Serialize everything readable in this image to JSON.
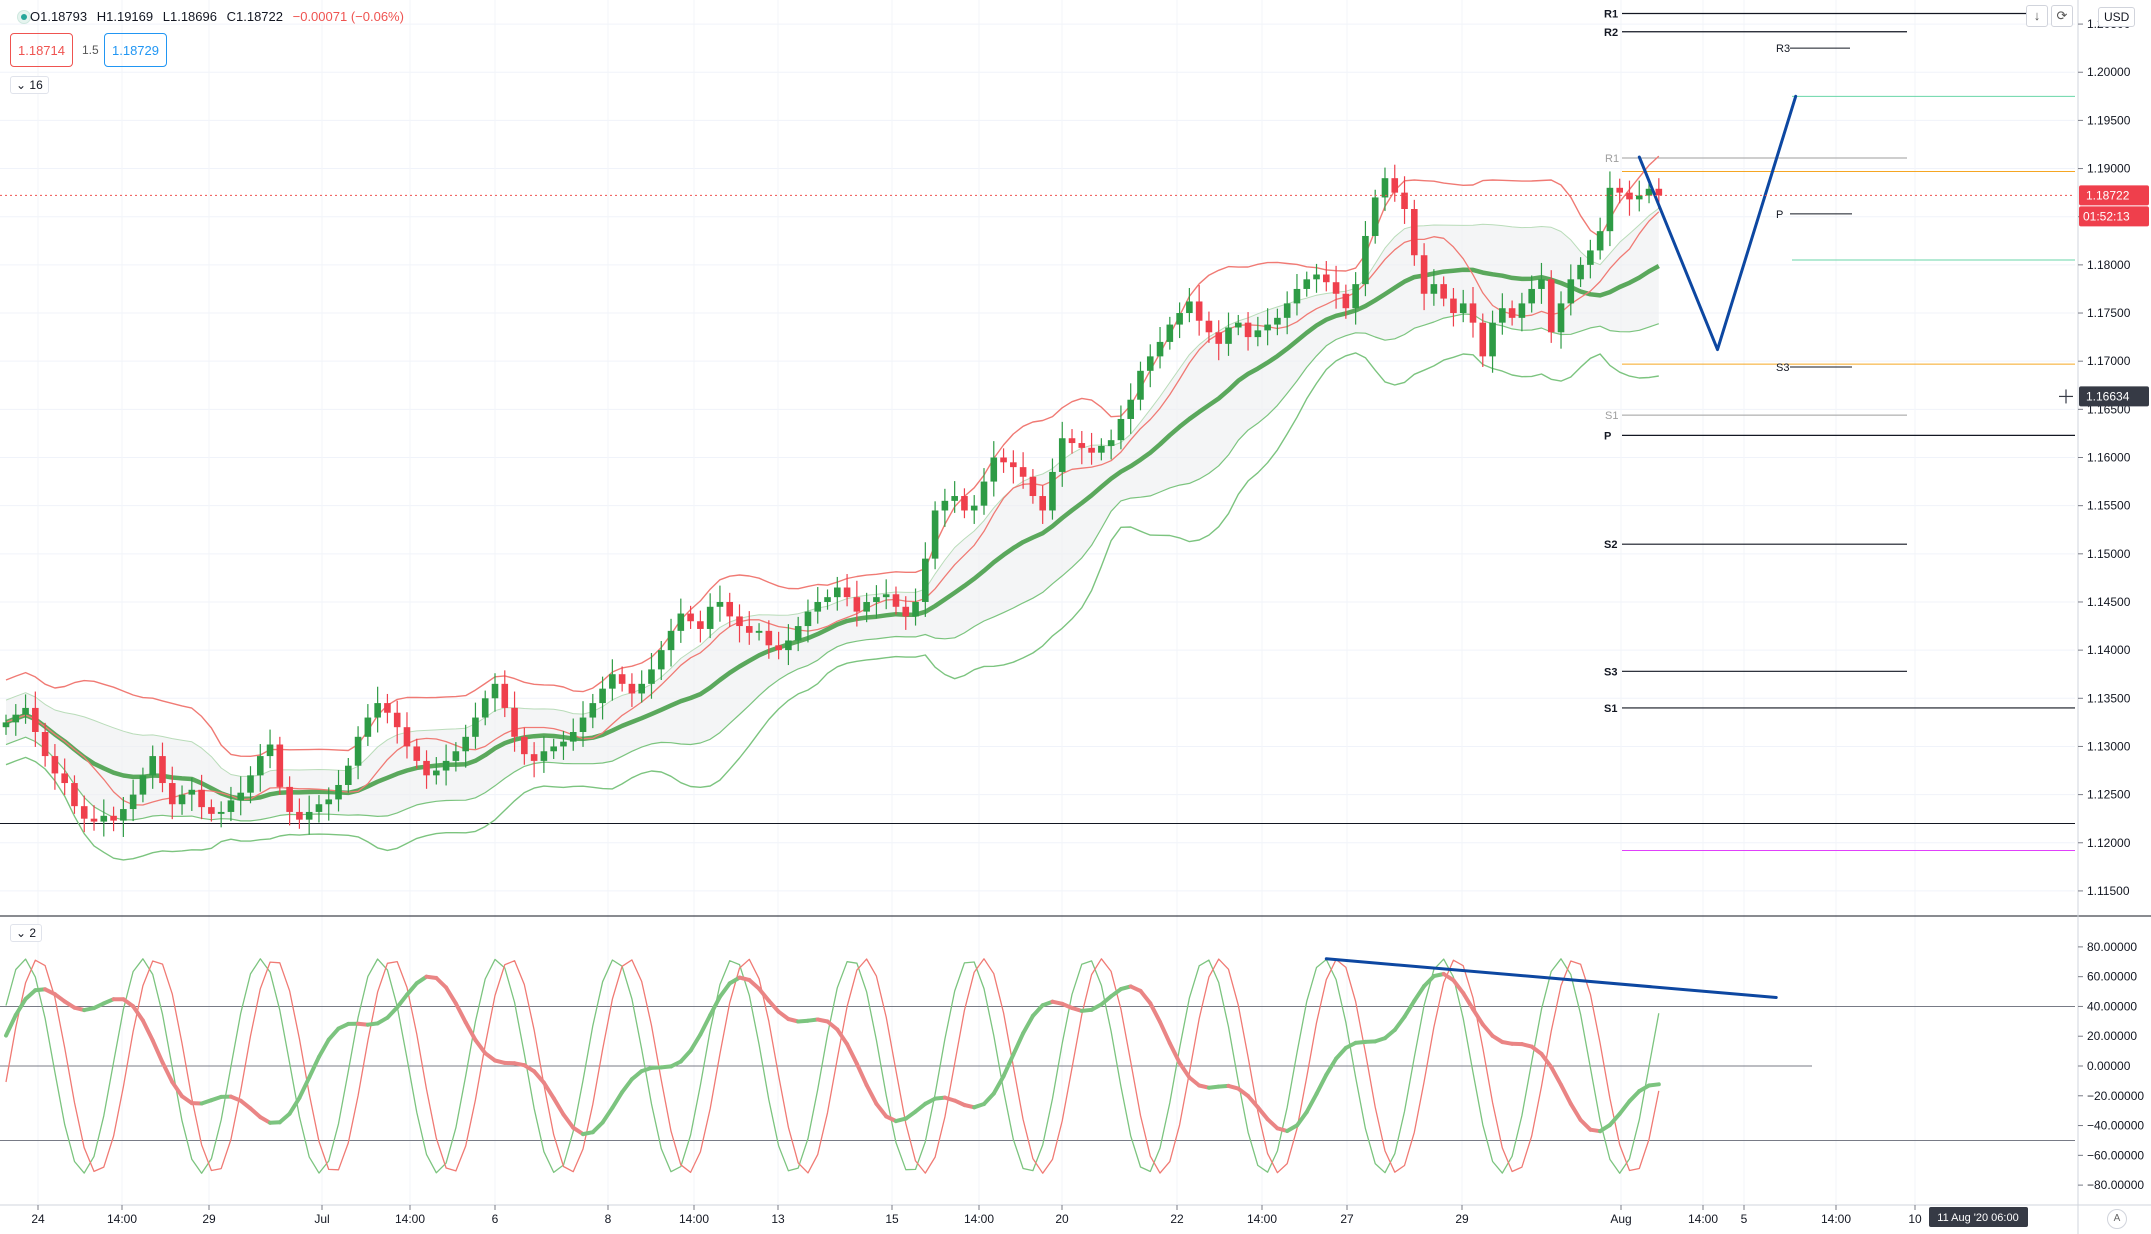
{
  "header": {
    "open": "O1.18793",
    "high": "H1.19169",
    "low": "L1.18696",
    "close": "C1.18722",
    "change": "−0.00071 (−0.06%)",
    "sell_price": "1.18714",
    "spread": "1.5",
    "buy_price": "1.18729",
    "main_collapse": "16",
    "osc_collapse": "2",
    "currency": "USD"
  },
  "colors": {
    "up": "#2e9b45",
    "down": "#ef3f4c",
    "band_red": "#f07a74",
    "band_green": "#7cc47f",
    "basis_green": "#5aa85c",
    "drawing_blue": "#0d47a1",
    "orange_level": "#f5a623",
    "teal_level": "#69d6a8",
    "magenta_level": "#e040fb"
  },
  "labels": {
    "current_price": "1.18722",
    "countdown": "01:52:13",
    "cursor_price": "1.16634",
    "cursor_time": "11 Aug '20  06:00"
  },
  "pivots_main": [
    {
      "name": "R1",
      "value": 1.2061
    },
    {
      "name": "R2",
      "value": 1.2042
    },
    {
      "name": "P",
      "value": 1.1623
    },
    {
      "name": "S2",
      "value": 1.151
    },
    {
      "name": "S3",
      "value": 1.1378
    },
    {
      "name": "S1",
      "value": 1.134
    }
  ],
  "pivots_week": [
    {
      "name": "R3",
      "value": 1.2025
    },
    {
      "name": "R1",
      "value": 1.1911
    },
    {
      "name": "P",
      "value": 1.1853
    },
    {
      "name": "S3",
      "value": 1.1694
    },
    {
      "name": "S1",
      "value": 1.1644
    }
  ],
  "chart_data": [
    {
      "type": "candlestick",
      "y_ticks": [
        "1.20500",
        "1.20000",
        "1.19500",
        "1.19000",
        "1.18500",
        "1.18000",
        "1.17500",
        "1.17000",
        "1.16500",
        "1.16000",
        "1.15500",
        "1.15000",
        "1.14500",
        "1.14000",
        "1.13500",
        "1.13000",
        "1.12500",
        "1.12000",
        "1.11500"
      ],
      "x_ticks": [
        "24",
        "14:00",
        "29",
        "Jul",
        "14:00",
        "6",
        "8",
        "14:00",
        "13",
        "15",
        "14:00",
        "20",
        "22",
        "14:00",
        "27",
        "29",
        "Aug",
        "14:00",
        "5",
        "14:00",
        "10"
      ],
      "ylim": [
        1.1125,
        1.2075
      ],
      "closes": [
        1.1325,
        1.1333,
        1.134,
        1.1315,
        1.129,
        1.1272,
        1.1262,
        1.1238,
        1.1225,
        1.1222,
        1.1228,
        1.1223,
        1.1235,
        1.125,
        1.127,
        1.129,
        1.1262,
        1.124,
        1.125,
        1.1255,
        1.1237,
        1.123,
        1.1232,
        1.1244,
        1.1252,
        1.127,
        1.129,
        1.1302,
        1.1258,
        1.1232,
        1.1224,
        1.1232,
        1.124,
        1.1245,
        1.126,
        1.128,
        1.131,
        1.133,
        1.1345,
        1.1335,
        1.132,
        1.13,
        1.1285,
        1.127,
        1.1275,
        1.1285,
        1.1295,
        1.131,
        1.133,
        1.135,
        1.1365,
        1.134,
        1.131,
        1.1292,
        1.1285,
        1.1295,
        1.13,
        1.1305,
        1.1315,
        1.133,
        1.1345,
        1.136,
        1.1375,
        1.1365,
        1.1355,
        1.1365,
        1.138,
        1.14,
        1.142,
        1.1438,
        1.143,
        1.1422,
        1.1445,
        1.145,
        1.1435,
        1.1425,
        1.1418,
        1.142,
        1.1405,
        1.14,
        1.141,
        1.1425,
        1.144,
        1.145,
        1.1455,
        1.1465,
        1.1455,
        1.144,
        1.145,
        1.1455,
        1.1458,
        1.1445,
        1.1435,
        1.145,
        1.1495,
        1.1545,
        1.1555,
        1.156,
        1.1545,
        1.155,
        1.1575,
        1.16,
        1.1595,
        1.159,
        1.158,
        1.156,
        1.1545,
        1.1585,
        1.162,
        1.1615,
        1.161,
        1.1605,
        1.1612,
        1.1618,
        1.164,
        1.166,
        1.169,
        1.1705,
        1.172,
        1.1738,
        1.175,
        1.1762,
        1.1742,
        1.173,
        1.1718,
        1.1735,
        1.174,
        1.1725,
        1.1732,
        1.1738,
        1.1745,
        1.176,
        1.1775,
        1.1785,
        1.179,
        1.1782,
        1.177,
        1.1755,
        1.178,
        1.183,
        1.187,
        1.189,
        1.1875,
        1.1858,
        1.181,
        1.177,
        1.178,
        1.1765,
        1.175,
        1.176,
        1.174,
        1.1705,
        1.174,
        1.1755,
        1.1745,
        1.176,
        1.1775,
        1.1785,
        1.173,
        1.176,
        1.1785,
        1.18,
        1.1815,
        1.1835,
        1.188,
        1.1875,
        1.1868,
        1.1872,
        1.1879,
        1.18722
      ],
      "overlays": [
        "bollinger",
        "moving average",
        "keltner"
      ],
      "projection": [
        [
          167,
          1.1912
        ],
        [
          175,
          1.1712
        ],
        [
          183,
          1.1975
        ]
      ],
      "horizontal_levels": [
        1.122,
        1.1192,
        1.1975,
        1.1897,
        1.1697,
        1.1805
      ]
    },
    {
      "type": "line",
      "name": "oscillator",
      "y_ticks": [
        "80.00000",
        "60.00000",
        "40.00000",
        "20.00000",
        "0.00000",
        "−20.00000",
        "−40.00000",
        "−60.00000",
        "−80.00000"
      ],
      "ylim": [
        -90,
        90
      ],
      "levels": [
        40,
        0,
        -50
      ],
      "trendline": [
        [
          135,
          72
        ],
        [
          181,
          46
        ]
      ]
    }
  ]
}
